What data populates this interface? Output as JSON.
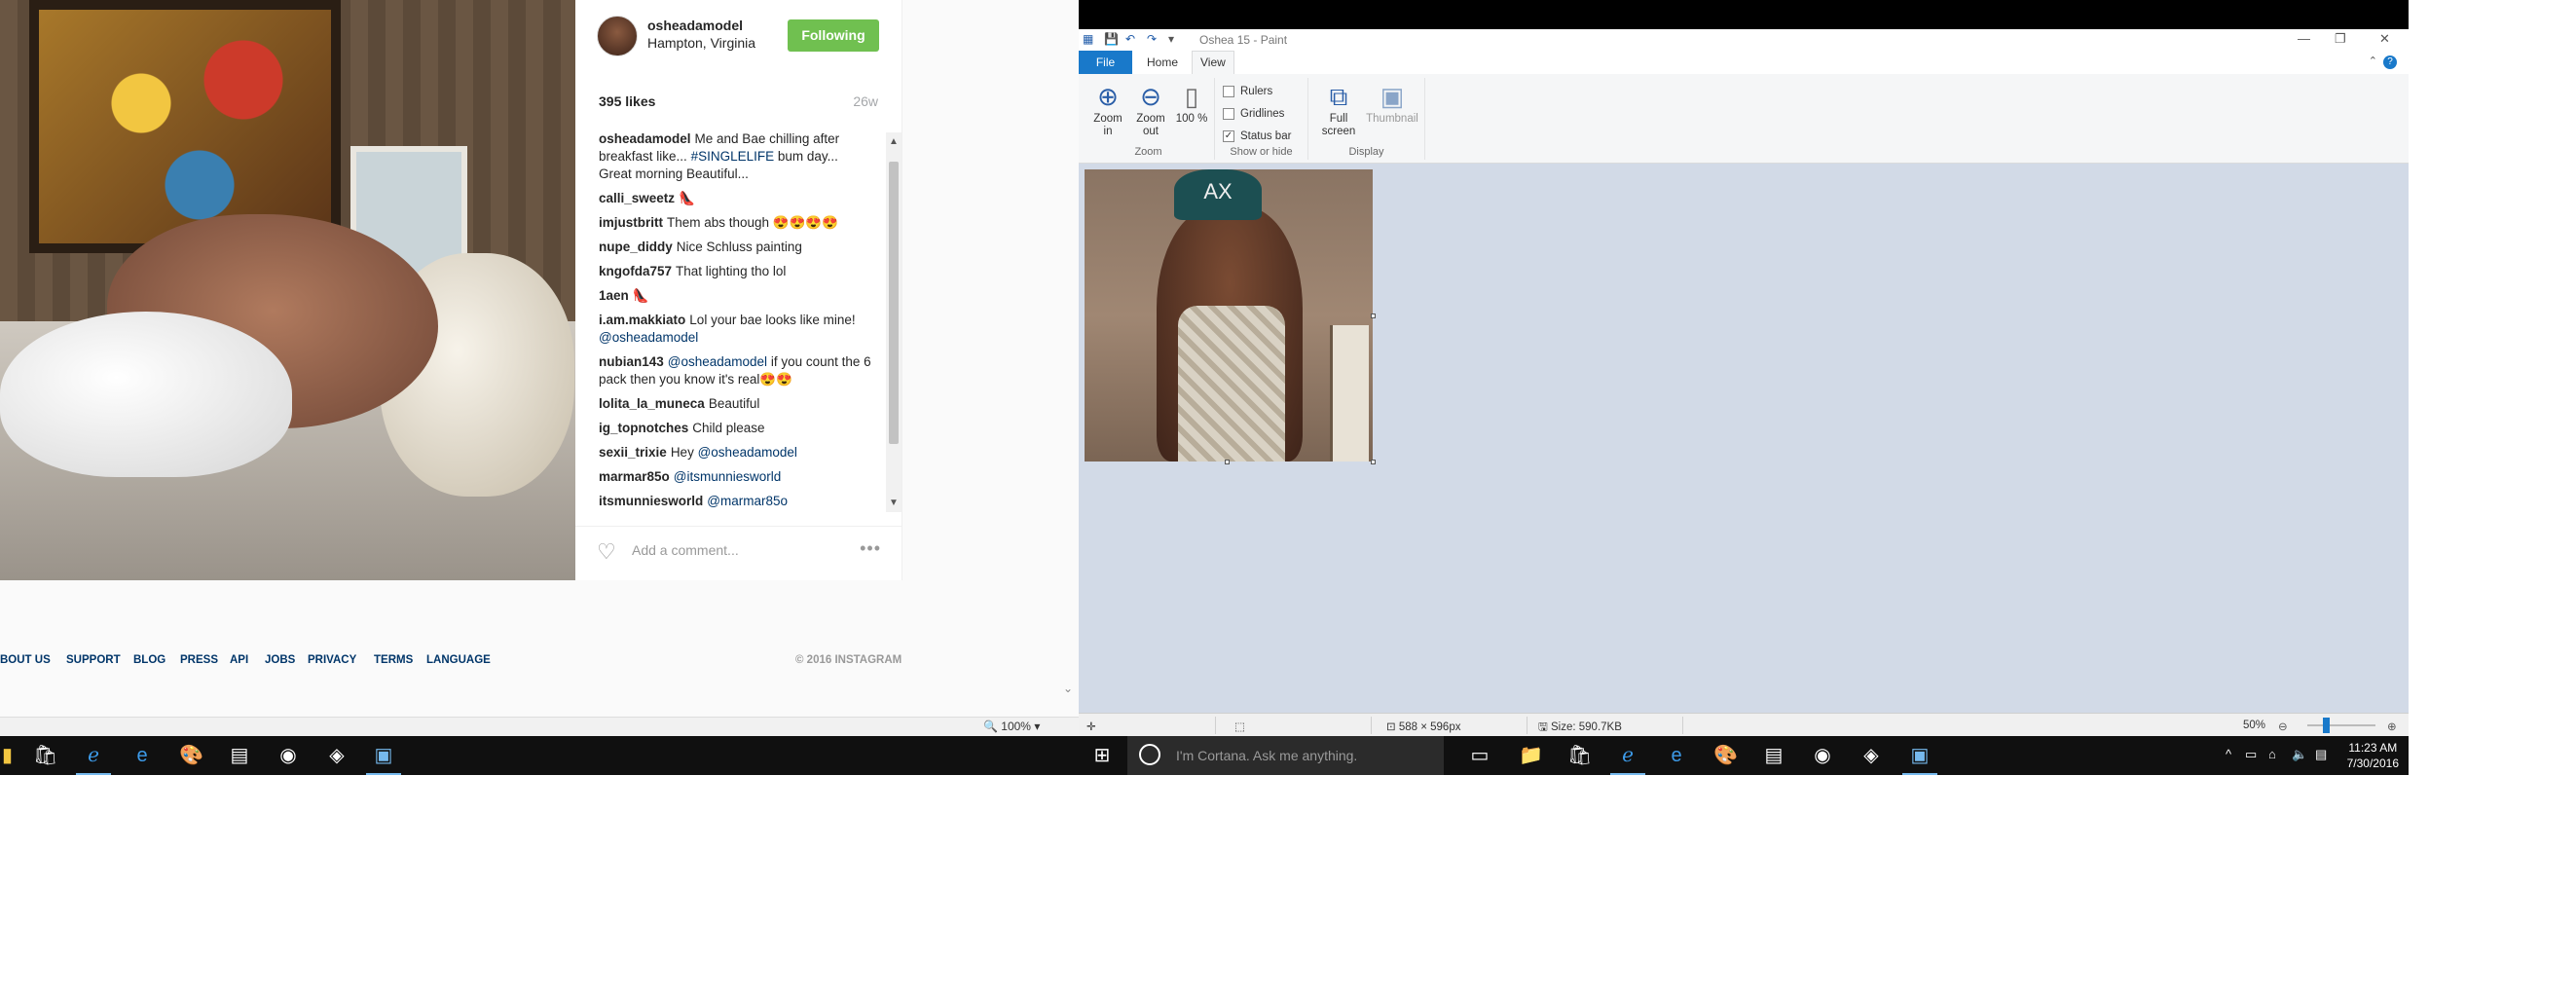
{
  "instagram": {
    "username": "osheadamodel",
    "location": "Hampton, Virginia",
    "follow_label": "Following",
    "likes": "395 likes",
    "age": "26w",
    "comments": [
      {
        "user": "osheadamodel",
        "text": "Me and Bae chilling after breakfast like...",
        "mention": "#SINGLELIFE",
        "rest": "bum day... Great morning Beautiful..."
      },
      {
        "user": "calli_sweetz",
        "text": "👠",
        "mention": "",
        "rest": ""
      },
      {
        "user": "imjustbritt",
        "text": "Them abs though 😍😍😍😍",
        "mention": "",
        "rest": ""
      },
      {
        "user": "nupe_diddy",
        "text": "Nice Schluss painting",
        "mention": "",
        "rest": ""
      },
      {
        "user": "kngofda757",
        "text": "That lighting tho lol",
        "mention": "",
        "rest": ""
      },
      {
        "user": "1aen",
        "text": "👠",
        "mention": "",
        "rest": ""
      },
      {
        "user": "i.am.makkiato",
        "text": "Lol your bae looks like mine!",
        "mention": "@osheadamodel",
        "rest": ""
      },
      {
        "user": "nubian143",
        "text": "",
        "mention": "@osheadamodel",
        "rest": "if you count the 6 pack then you know it's real😍😍"
      },
      {
        "user": "lolita_la_muneca",
        "text": "Beautiful",
        "mention": "",
        "rest": ""
      },
      {
        "user": "ig_topnotches",
        "text": "Child please",
        "mention": "",
        "rest": ""
      },
      {
        "user": "sexii_trixie",
        "text": "Hey",
        "mention": "@osheadamodel",
        "rest": ""
      },
      {
        "user": "marmar85o",
        "text": "",
        "mention": "@itsmunniesworld",
        "rest": ""
      },
      {
        "user": "itsmunniesworld",
        "text": "",
        "mention": "@marmar85o",
        "rest": ""
      }
    ],
    "add_comment_placeholder": "Add a comment...",
    "more": "•••",
    "footer_links": [
      "BOUT US",
      "SUPPORT",
      "BLOG",
      "PRESS",
      "API",
      "JOBS",
      "PRIVACY",
      "TERMS",
      "LANGUAGE"
    ],
    "copyright": "© 2016 INSTAGRAM",
    "zoom": "100%"
  },
  "paint": {
    "title": "Oshea 15 - Paint",
    "tabs": {
      "file": "File",
      "home": "Home",
      "view": "View"
    },
    "zoom_group": {
      "label": "Zoom",
      "zoom_in": "Zoom in",
      "zoom_out": "Zoom out",
      "hundred": "100 %"
    },
    "show_hide": {
      "label": "Show or hide",
      "rulers": "Rulers",
      "gridlines": "Gridlines",
      "status_bar": "Status bar",
      "rulers_checked": false,
      "gridlines_checked": false,
      "status_bar_checked": true
    },
    "display": {
      "label": "Display",
      "full_screen": "Full screen",
      "thumbnail": "Thumbnail"
    },
    "status": {
      "dimensions": "588 × 596px",
      "size": "Size: 590.7KB",
      "zoom": "50%"
    },
    "canvas_logo": "AX"
  },
  "taskbar": {
    "cortana_placeholder": "I'm Cortana. Ask me anything.",
    "time": "11:23 AM",
    "date": "7/30/2016"
  },
  "colors": {
    "follow_green": "#70c050",
    "link_blue": "#003569",
    "paint_accent": "#1979ca",
    "canvas_bg": "#d2dae7",
    "taskbar": "#101010"
  }
}
